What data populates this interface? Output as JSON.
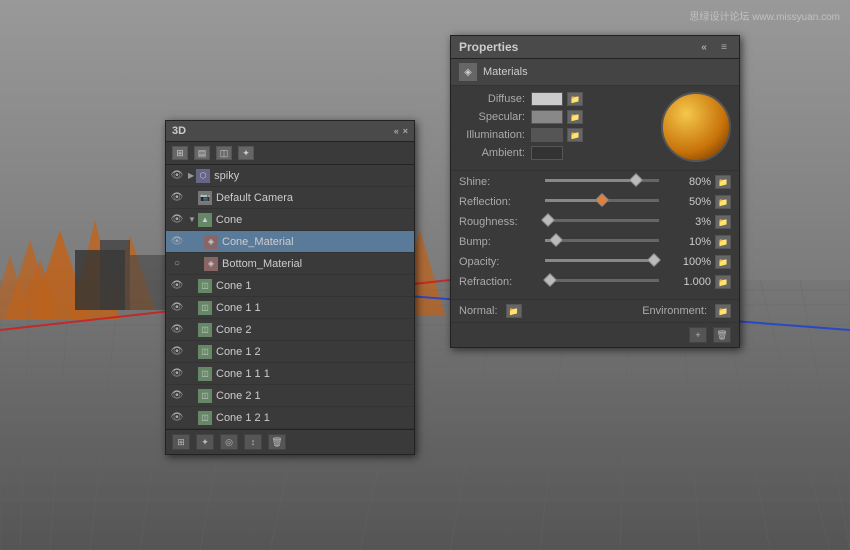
{
  "viewport": {
    "watermark": "思绿设计论坛 www.missyuan.com"
  },
  "panel3d": {
    "title": "3D",
    "collapse_icon": "«",
    "close_icon": "×",
    "layers": [
      {
        "id": 1,
        "name": "spiky",
        "indent": 0,
        "type": "mesh",
        "visible": true,
        "expanded": true
      },
      {
        "id": 2,
        "name": "Default Camera",
        "indent": 0,
        "type": "camera",
        "visible": true
      },
      {
        "id": 3,
        "name": "Cone",
        "indent": 0,
        "type": "cone",
        "visible": true,
        "expanded": true
      },
      {
        "id": 4,
        "name": "Cone_Material",
        "indent": 1,
        "type": "material",
        "visible": true,
        "selected": true
      },
      {
        "id": 5,
        "name": "Bottom_Material",
        "indent": 1,
        "type": "material",
        "visible": false
      },
      {
        "id": 6,
        "name": "Cone 1",
        "indent": 0,
        "type": "cone",
        "visible": true
      },
      {
        "id": 7,
        "name": "Cone 1 1",
        "indent": 0,
        "type": "cone",
        "visible": true
      },
      {
        "id": 8,
        "name": "Cone 2",
        "indent": 0,
        "type": "cone",
        "visible": true
      },
      {
        "id": 9,
        "name": "Cone 1 2",
        "indent": 0,
        "type": "cone",
        "visible": true
      },
      {
        "id": 10,
        "name": "Cone 1 1 1",
        "indent": 0,
        "type": "cone",
        "visible": true
      },
      {
        "id": 11,
        "name": "Cone 2 1",
        "indent": 0,
        "type": "cone",
        "visible": true
      },
      {
        "id": 12,
        "name": "Cone 1 2 1",
        "indent": 0,
        "type": "cone",
        "visible": true
      }
    ],
    "bottom_icons": [
      "grid",
      "light",
      "target",
      "move",
      "trash"
    ]
  },
  "properties": {
    "title": "Properties",
    "collapse_icon": "«",
    "menu_icon": "≡",
    "tab": "Materials",
    "tab_icon": "◈",
    "preview_sphere": "gold metallic sphere",
    "materials": {
      "diffuse_label": "Diffuse:",
      "diffuse_swatch": "#cccccc",
      "specular_label": "Specular:",
      "specular_swatch": "#888888",
      "illumination_label": "Illumination:",
      "illumination_swatch": "#555555",
      "ambient_label": "Ambient:",
      "ambient_swatch": "#333333"
    },
    "sliders": [
      {
        "label": "Shine:",
        "value": "80%",
        "fill_pct": 80,
        "thumb_type": "normal"
      },
      {
        "label": "Reflection:",
        "value": "50%",
        "fill_pct": 50,
        "thumb_type": "orange"
      },
      {
        "label": "Roughness:",
        "value": "3%",
        "fill_pct": 3,
        "thumb_type": "normal"
      },
      {
        "label": "Bump:",
        "value": "10%",
        "fill_pct": 10,
        "thumb_type": "normal"
      },
      {
        "label": "Opacity:",
        "value": "100%",
        "fill_pct": 100,
        "thumb_type": "normal"
      },
      {
        "label": "Refraction:",
        "value": "1.000",
        "fill_pct": 0,
        "thumb_type": "normal"
      }
    ],
    "bottom": {
      "normal_label": "Normal:",
      "environment_label": "Environment:"
    },
    "footer_icons": [
      "new",
      "trash"
    ]
  }
}
